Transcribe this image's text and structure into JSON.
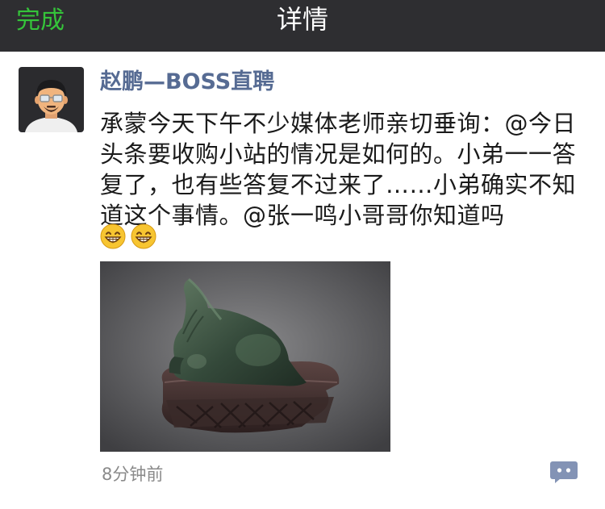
{
  "nav": {
    "done_label": "完成",
    "title": "详情"
  },
  "post": {
    "author": "赵鹏—BOSS直聘",
    "content": "承蒙今天下午不少媒体老师亲切垂询：@今日头条要收购小站的情况是如何的。小弟一一答复了，也有些答复不过来了……小弟确实不知道这个事情。@张一鸣小哥哥你知道吗",
    "emojis": [
      "grin-emoji",
      "grin-emoji"
    ],
    "time": "8分钟前",
    "image": "jade-horse-sculpture"
  },
  "colors": {
    "nav_bg": "#2e2e31",
    "accent_green": "#35c43a",
    "author_blue": "#566b93",
    "comment_icon": "#8393b5"
  },
  "icons": {
    "avatar": "cartoon-man-avatar",
    "comment": "comment-bubble-icon"
  }
}
